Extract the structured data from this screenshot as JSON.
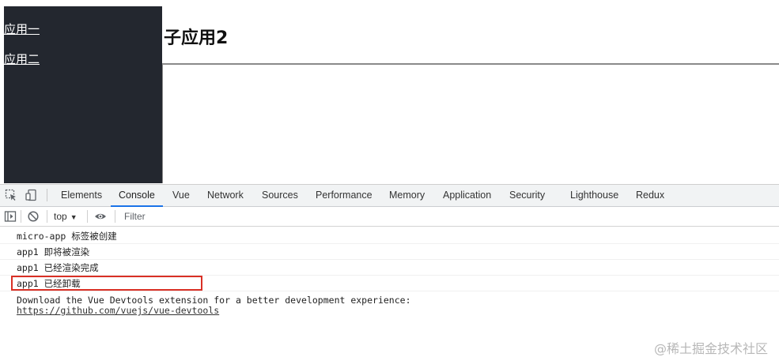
{
  "sidebar": {
    "links": [
      {
        "label": "应用一"
      },
      {
        "label": "应用二"
      }
    ]
  },
  "main": {
    "title": "子应用2"
  },
  "devtools": {
    "tabs": [
      {
        "label": "Elements"
      },
      {
        "label": "Console",
        "active": true
      },
      {
        "label": "Vue"
      },
      {
        "label": "Network"
      },
      {
        "label": "Sources"
      },
      {
        "label": "Performance"
      },
      {
        "label": "Memory"
      },
      {
        "label": "Application"
      },
      {
        "label": "Security"
      },
      {
        "label": "Lighthouse"
      },
      {
        "label": "Redux"
      }
    ],
    "toolbar": {
      "context": "top",
      "filter_placeholder": "Filter"
    },
    "console": {
      "messages": [
        {
          "text": "micro-app 标签被创建"
        },
        {
          "text": "app1 即将被渲染"
        },
        {
          "text": "app1 已经渲染完成"
        },
        {
          "text": "app1 已经卸载",
          "highlighted": true
        }
      ],
      "devtools_hint": {
        "text": "Download the Vue Devtools extension for a better development experience:",
        "link": "https://github.com/vuejs/vue-devtools"
      }
    },
    "accent_color": "#1a73e8",
    "highlight_color": "#d93025"
  },
  "watermark": "@稀土掘金技术社区"
}
